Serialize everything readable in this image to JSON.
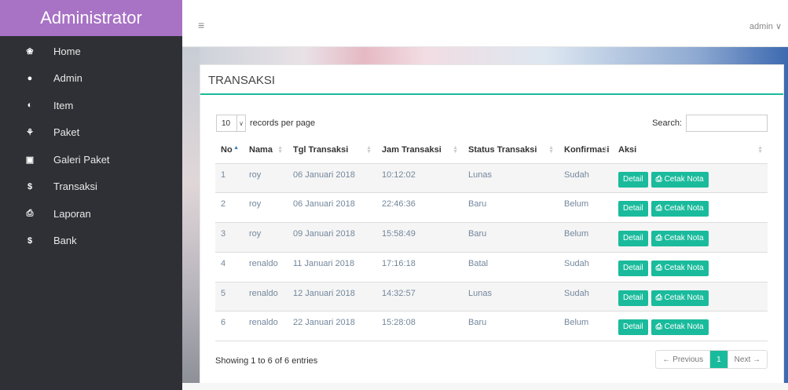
{
  "brand": "Administrator",
  "sidebar": {
    "items": [
      {
        "label": "Home",
        "icon": "❀"
      },
      {
        "label": "Admin",
        "icon": "●"
      },
      {
        "label": "Item",
        "icon": "◐"
      },
      {
        "label": "Paket",
        "icon": "⚘"
      },
      {
        "label": "Galeri Paket",
        "icon": "▣"
      },
      {
        "label": "Transaksi",
        "icon": "$"
      },
      {
        "label": "Laporan",
        "icon": "⎙"
      },
      {
        "label": "Bank",
        "icon": "$"
      }
    ]
  },
  "topbar": {
    "menu_icon": "≡",
    "user": "admin ∨"
  },
  "panel": {
    "title": "TRANSAKSI",
    "length_value": "10",
    "length_arrow": "∨",
    "length_text": "records per page",
    "search_label": "Search:",
    "columns": [
      "No",
      "Nama",
      "Tgl Transaksi",
      "Jam Transaksi",
      "Status Transaksi",
      "Konfirmasi",
      "Aksi"
    ],
    "rows": [
      {
        "no": "1",
        "nama": "roy",
        "tgl": "06 Januari 2018",
        "jam": "10:12:02",
        "status": "Lunas",
        "konfirmasi": "Sudah"
      },
      {
        "no": "2",
        "nama": "roy",
        "tgl": "06 Januari 2018",
        "jam": "22:46:36",
        "status": "Baru",
        "konfirmasi": "Belum"
      },
      {
        "no": "3",
        "nama": "roy",
        "tgl": "09 Januari 2018",
        "jam": "15:58:49",
        "status": "Baru",
        "konfirmasi": "Belum"
      },
      {
        "no": "4",
        "nama": "renaldo",
        "tgl": "11 Januari 2018",
        "jam": "17:16:18",
        "status": "Batal",
        "konfirmasi": "Sudah"
      },
      {
        "no": "5",
        "nama": "renaldo",
        "tgl": "12 Januari 2018",
        "jam": "14:32:57",
        "status": "Lunas",
        "konfirmasi": "Sudah"
      },
      {
        "no": "6",
        "nama": "renaldo",
        "tgl": "22 Januari 2018",
        "jam": "15:28:08",
        "status": "Baru",
        "konfirmasi": "Belum"
      }
    ],
    "detail_label": "Detail",
    "cetak_label": "Cetak Nota",
    "info": "Showing 1 to 6 of 6 entries",
    "pagination": {
      "previous": "← Previous",
      "page": "1",
      "next": "Next →"
    }
  },
  "colors": {
    "accent": "#1abb9c",
    "brand_bg": "#a872c5",
    "sidebar_bg": "#2f3035"
  }
}
